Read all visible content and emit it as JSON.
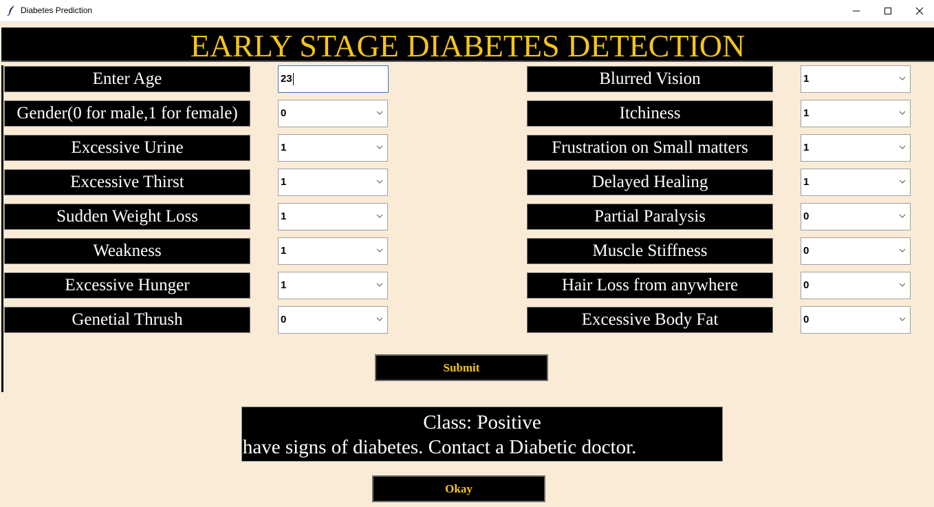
{
  "window": {
    "title": "Diabetes Prediction",
    "controls": [
      "minimize",
      "maximize",
      "close"
    ]
  },
  "header": {
    "title": "EARLY STAGE DIABETES DETECTION"
  },
  "colors": {
    "background": "#faebd7",
    "panel": "#000000",
    "accent": "#f5c518",
    "text": "#ffffff"
  },
  "form": {
    "left": [
      {
        "label": "Enter Age",
        "value": "23",
        "type": "entry"
      },
      {
        "label": "Gender(0 for male,1 for female)",
        "value": "0",
        "type": "combo"
      },
      {
        "label": "Excessive Urine",
        "value": "1",
        "type": "combo"
      },
      {
        "label": "Excessive Thirst",
        "value": "1",
        "type": "combo"
      },
      {
        "label": "Sudden Weight Loss",
        "value": "1",
        "type": "combo"
      },
      {
        "label": "Weakness",
        "value": "1",
        "type": "combo"
      },
      {
        "label": "Excessive Hunger",
        "value": "1",
        "type": "combo"
      },
      {
        "label": "Genetial Thrush",
        "value": "0",
        "type": "combo"
      }
    ],
    "right": [
      {
        "label": "Blurred Vision",
        "value": "1",
        "type": "combo"
      },
      {
        "label": "Itchiness",
        "value": "1",
        "type": "combo"
      },
      {
        "label": "Frustration on Small matters",
        "value": "1",
        "type": "combo"
      },
      {
        "label": "Delayed Healing",
        "value": "1",
        "type": "combo"
      },
      {
        "label": "Partial Paralysis",
        "value": "0",
        "type": "combo"
      },
      {
        "label": "Muscle Stiffness",
        "value": "0",
        "type": "combo"
      },
      {
        "label": "Hair Loss from anywhere",
        "value": "0",
        "type": "combo"
      },
      {
        "label": "Excessive Body Fat",
        "value": "0",
        "type": "combo"
      }
    ],
    "submit_label": "Submit"
  },
  "result": {
    "class_text": "Class: Positive",
    "message": "Positive - You have signs of diabetes. Contact a Diabetic doctor."
  },
  "okay_label": "Okay"
}
